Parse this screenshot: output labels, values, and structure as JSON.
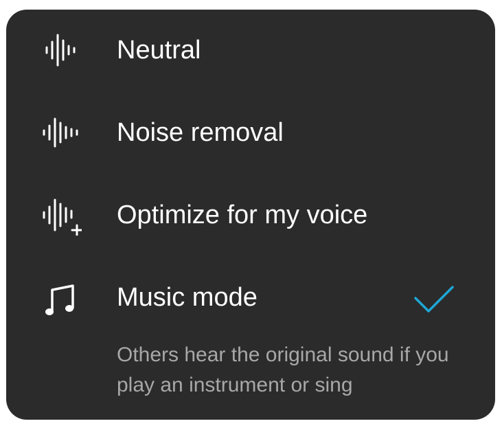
{
  "menu": {
    "items": [
      {
        "label": "Neutral",
        "icon": "neutral-waveform-icon",
        "selected": false
      },
      {
        "label": "Noise removal",
        "icon": "noise-removal-waveform-icon",
        "selected": false
      },
      {
        "label": "Optimize for my voice",
        "icon": "voice-optimize-waveform-icon",
        "selected": false
      },
      {
        "label": "Music mode",
        "icon": "music-note-icon",
        "selected": true,
        "description": "Others hear the original sound if you play an instrument or sing"
      }
    ]
  },
  "colors": {
    "background": "#2b2b2b",
    "text": "#ffffff",
    "secondary_text": "#a8a8a8",
    "accent": "#1ea7d6"
  }
}
